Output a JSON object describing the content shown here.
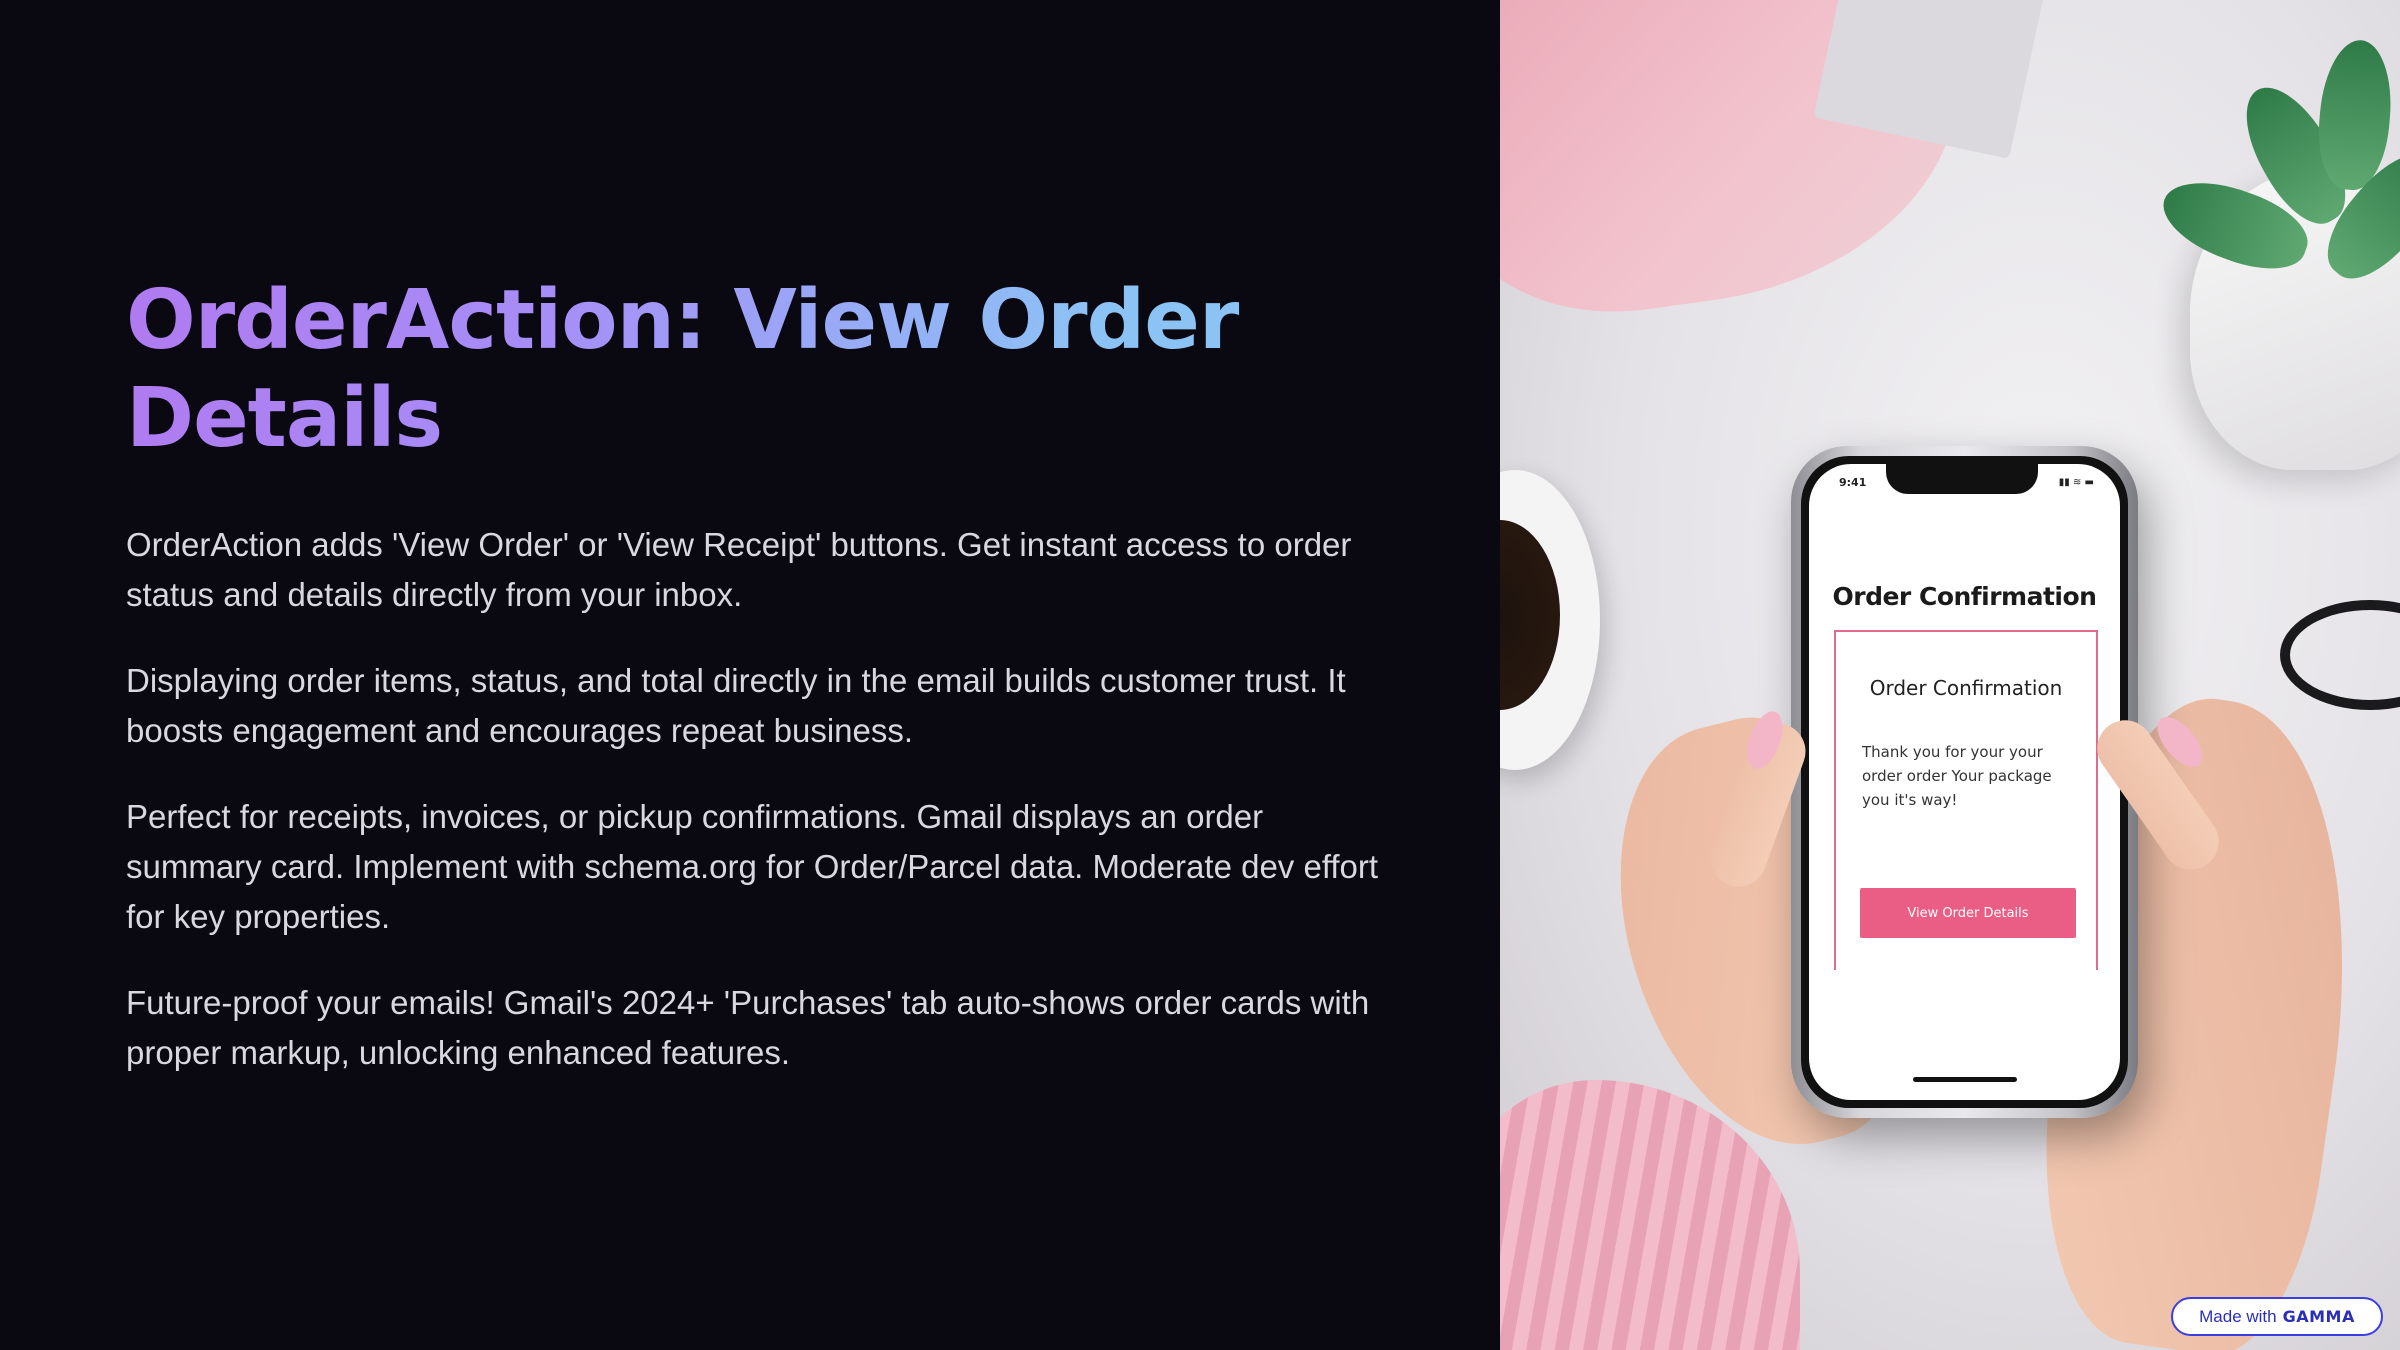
{
  "slide": {
    "title": "OrderAction: View Order Details",
    "paragraphs": [
      "OrderAction adds 'View Order' or 'View Receipt' buttons. Get instant access to order status and details directly from your inbox.",
      "Displaying order items, status, and total directly in the email builds customer trust. It boosts engagement and encourages repeat business.",
      "Perfect for receipts, invoices, or pickup confirmations. Gmail displays an order summary card. Implement with schema.org for Order/Parcel data. Moderate dev effort for key properties.",
      "Future-proof your emails! Gmail's 2024+ 'Purchases' tab auto-shows order cards with proper markup, unlocking enhanced features."
    ]
  },
  "phone": {
    "clock": "9:41",
    "status_icons": "▮▮ ≋ ▬",
    "heading": "Order Confirmation",
    "card": {
      "title": "Order Confirmation",
      "text": "Thank you for your your order order Your package you it's way!",
      "button_label": "View Order Details"
    }
  },
  "badge": {
    "made_with": "Made with",
    "brand": "GAMMA"
  },
  "colors": {
    "background": "#0a0911",
    "title_gradient_start": "#b07af0",
    "title_gradient_end": "#8cc3f5",
    "body_text": "#d9d8df",
    "phone_button": "#ea5d85",
    "badge_border": "#3b3ee0"
  }
}
